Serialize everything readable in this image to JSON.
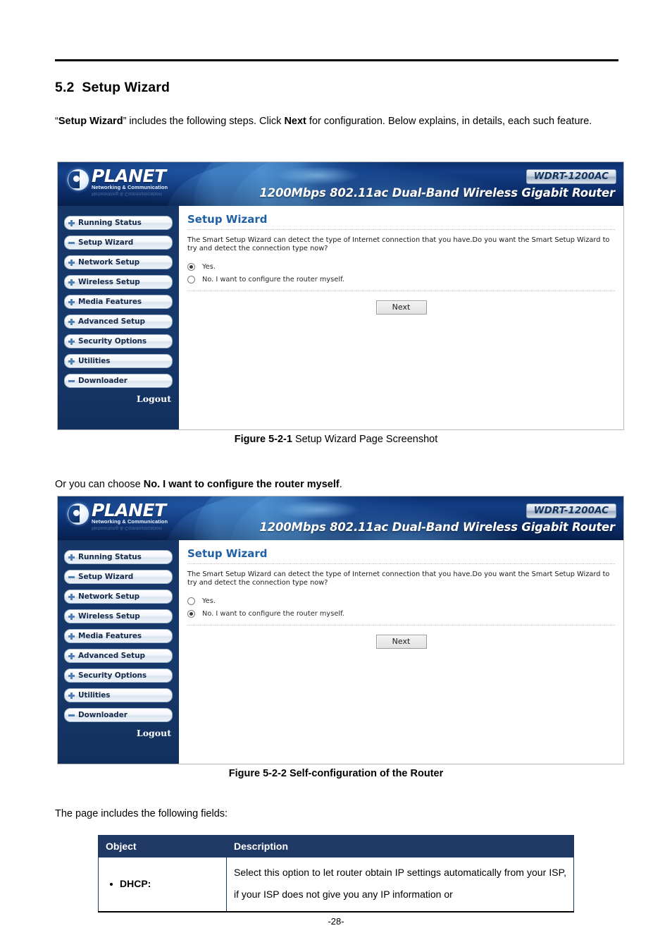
{
  "document": {
    "section_number": "5.2",
    "section_title": "Setup Wizard",
    "intro_part1": "“",
    "intro_bold1": "Setup Wizard",
    "intro_part2": "” includes the following steps. Click ",
    "intro_bold2": "Next",
    "intro_part3": " for configuration. Below explains, in details, each such feature.",
    "choose_part1": "Or you can choose ",
    "choose_bold": "No. I want to configure the router myself",
    "choose_part2": ".",
    "fields_intro": "The page includes the following fields:",
    "page_number": "-28-"
  },
  "figures": [
    {
      "caption_lead": "Figure 5-2-1",
      "caption_rest": " Setup Wizard Page Screenshot"
    },
    {
      "caption_lead": "Figure 5-2-2 Self-configuration of the Router",
      "caption_rest": ""
    }
  ],
  "router_ui": {
    "brand": {
      "name": "PLANET",
      "tagline": "Networking & Communication",
      "model_badge": "WDRT-1200AC",
      "model_description": "1200Mbps 802.11ac Dual-Band Wireless Gigabit Router"
    },
    "sidebar": {
      "items": [
        {
          "label": "Running Status",
          "icon": "plus-icon"
        },
        {
          "label": "Setup Wizard",
          "icon": "minus-icon"
        },
        {
          "label": "Network Setup",
          "icon": "plus-icon"
        },
        {
          "label": "Wireless Setup",
          "icon": "plus-icon"
        },
        {
          "label": "Media Features",
          "icon": "plus-icon"
        },
        {
          "label": "Advanced Setup",
          "icon": "plus-icon"
        },
        {
          "label": "Security Options",
          "icon": "plus-icon"
        },
        {
          "label": "Utilities",
          "icon": "plus-icon"
        },
        {
          "label": "Downloader",
          "icon": "minus-icon"
        }
      ],
      "logout_label": "Logout"
    },
    "content": {
      "title": "Setup Wizard",
      "description": "The Smart Setup Wizard can detect the type of Internet connection that you have.Do you want the Smart Setup Wizard to try and detect the connection type now?",
      "option_yes": "Yes.",
      "option_no": "No. I want to configure the router myself.",
      "next_button": "Next"
    },
    "selection": {
      "shot1": "yes",
      "shot2": "no"
    },
    "colors": {
      "banner_dark": "#0b2f6b",
      "sidebar": "#153667",
      "title_blue": "#1f5fa8",
      "table_header": "#1f3864"
    }
  },
  "table": {
    "headers": [
      "Object",
      "Description"
    ],
    "rows": [
      {
        "object": "DHCP:",
        "description": "Select this option to let router obtain IP settings automatically from your ISP, if your ISP does not give you any IP information or"
      }
    ]
  }
}
